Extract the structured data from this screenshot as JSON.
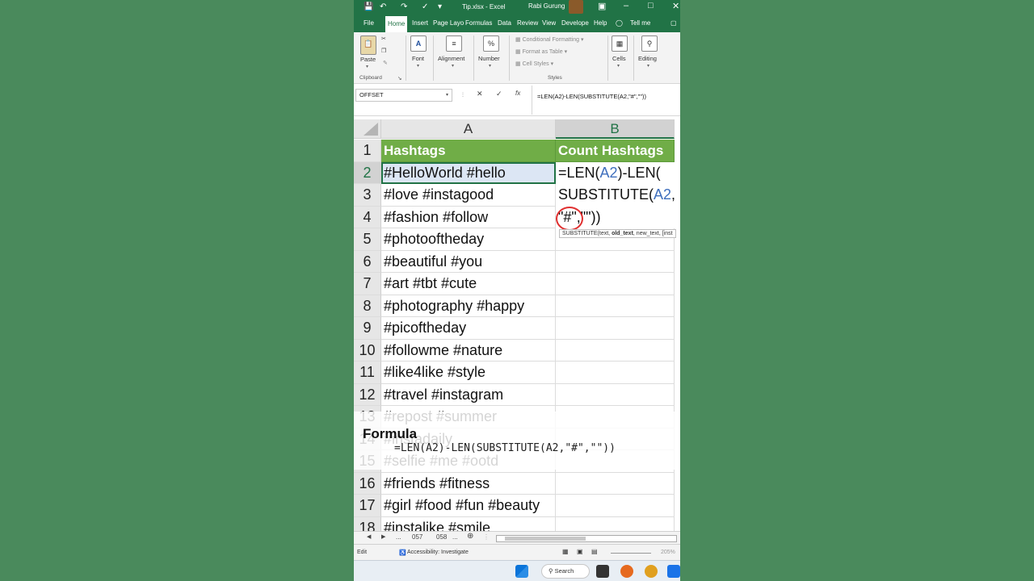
{
  "titlebar": {
    "filename": "Tip.xlsx  -  Excel",
    "user": "Rabi Gurung"
  },
  "ribbon_tabs": [
    "File",
    "Home",
    "Insert",
    "Page Layo",
    "Formulas",
    "Data",
    "Review",
    "View",
    "Develope",
    "Help",
    "Tell me"
  ],
  "ribbon": {
    "paste": "Paste",
    "clipboard": "Clipboard",
    "font": "Font",
    "alignment": "Alignment",
    "number": "Number",
    "conditional_formatting": "Conditional Formatting",
    "format_as_table": "Format as Table",
    "cell_styles": "Cell Styles",
    "styles": "Styles",
    "cells": "Cells",
    "editing": "Editing"
  },
  "formula_bar": {
    "name_box": "OFFSET",
    "fx": "fx",
    "formula": "=LEN(A2)-LEN(SUBSTITUTE(A2,\"#\",\"\"))"
  },
  "columns": [
    "A",
    "B"
  ],
  "header_row": {
    "row": "1",
    "a": "Hashtags",
    "b": "Count Hashtags"
  },
  "rows": [
    {
      "n": "2",
      "a": "#HelloWorld #hello"
    },
    {
      "n": "3",
      "a": "#love #instagood"
    },
    {
      "n": "4",
      "a": "#fashion #follow"
    },
    {
      "n": "5",
      "a": "#photooftheday"
    },
    {
      "n": "6",
      "a": "#beautiful #you"
    },
    {
      "n": "7",
      "a": "#art #tbt #cute"
    },
    {
      "n": "8",
      "a": "#photography #happy"
    },
    {
      "n": "9",
      "a": "#picoftheday"
    },
    {
      "n": "10",
      "a": "#followme #nature"
    },
    {
      "n": "11",
      "a": "#like4like #style"
    },
    {
      "n": "12",
      "a": "#travel #instagram"
    },
    {
      "n": "13",
      "a": "#repost #summer"
    },
    {
      "n": "14",
      "a": "#instadaily"
    },
    {
      "n": "15",
      "a": "#selfie #me #ootd"
    },
    {
      "n": "16",
      "a": "#friends #fitness"
    },
    {
      "n": "17",
      "a": "#girl #food #fun #beauty"
    },
    {
      "n": "18",
      "a": "#instalike #smile"
    }
  ],
  "edit_cell": {
    "line1_a": "=LEN(",
    "line1_ref": "A2",
    "line1_b": ")-LEN(",
    "line2_a": "SUBSTITUTE(",
    "line2_ref": "A2",
    "line2_b": ",",
    "line3": "\"#\",\"\"))",
    "tooltip_a": "SUBSTITUTE(text, ",
    "tooltip_b": "old_text",
    "tooltip_c": ", new_text, [inst"
  },
  "overlay": {
    "title": "Formula",
    "formula": "=LEN(A2)-LEN(SUBSTITUTE(A2,\"#\",\"\"))"
  },
  "sheet_tabs": [
    "...",
    "057",
    "058",
    "..."
  ],
  "status": {
    "mode": "Edit",
    "accessibility": "Accessibility: Investigate",
    "zoom": "205%"
  },
  "taskbar": {
    "search": "Search"
  },
  "colors": {
    "excel_green": "#217346",
    "header_fill": "#70ad47",
    "reference_blue": "#3f6fbd",
    "background": "#4a8a5c"
  }
}
